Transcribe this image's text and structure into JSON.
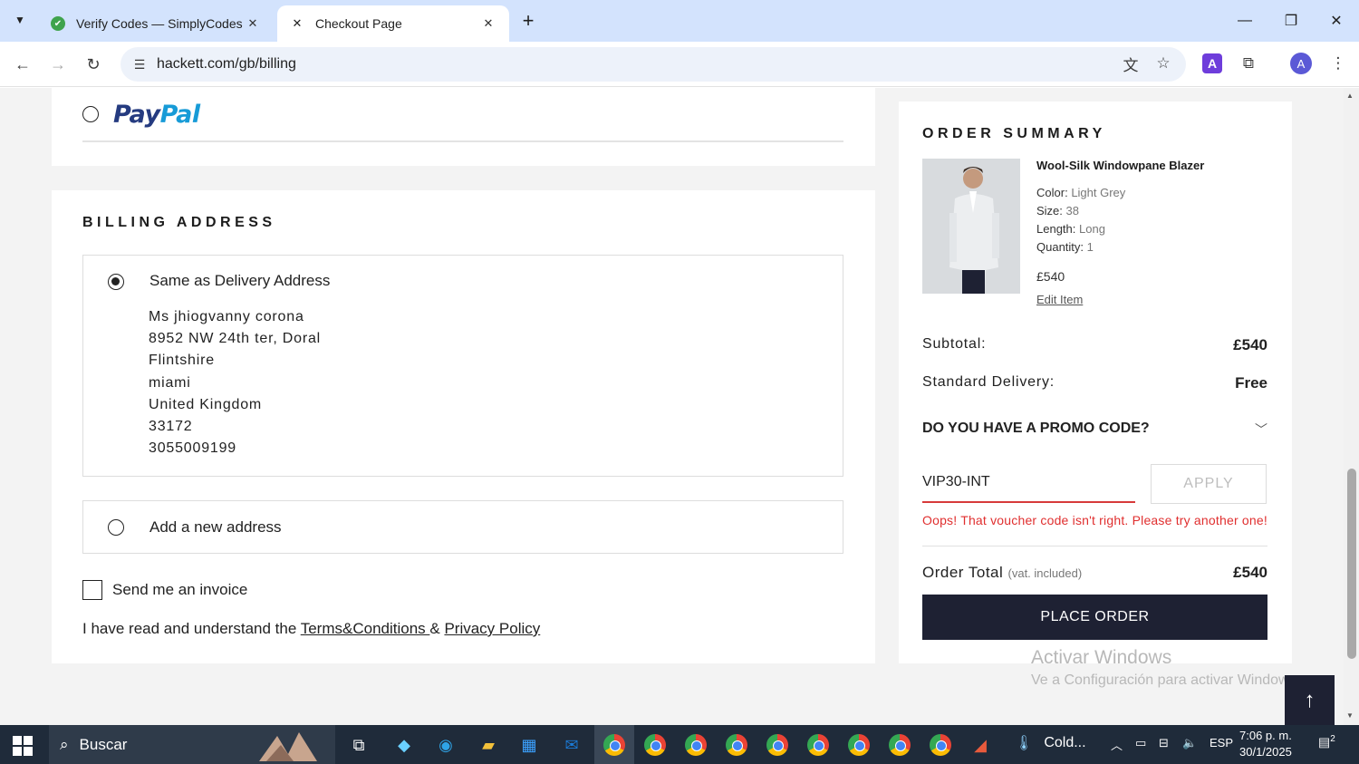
{
  "browser": {
    "tabs": [
      {
        "title": "Verify Codes — SimplyCodes",
        "active": false
      },
      {
        "title": "Checkout Page",
        "active": true
      }
    ],
    "url": "hackett.com/gb/billing"
  },
  "payment": {
    "paypal_logo_part1": "Pay",
    "paypal_logo_part2": "Pal"
  },
  "billing": {
    "title": "BILLING ADDRESS",
    "same_as_delivery_label": "Same as Delivery Address",
    "address_lines": [
      "Ms jhiogvanny corona",
      "8952 NW 24th ter, Doral",
      "Flintshire",
      "miami",
      "United Kingdom",
      "33172",
      "3055009199"
    ],
    "add_new_label": "Add a new address",
    "invoice_label": "Send me an invoice",
    "terms_prefix": "I have read and understand the ",
    "terms_link": "Terms&Conditions ",
    "terms_and": " & ",
    "privacy_link": "Privacy Policy"
  },
  "order_summary": {
    "title": "ORDER SUMMARY",
    "product": {
      "name": "Wool-Silk Windowpane Blazer",
      "color_label": "Color:",
      "color_value": "Light Grey",
      "size_label": "Size:",
      "size_value": "38",
      "length_label": "Length:",
      "length_value": "Long",
      "quantity_label": "Quantity:",
      "quantity_value": "1",
      "price": "£540",
      "edit_label": "Edit Item"
    },
    "subtotal_label": "Subtotal:",
    "subtotal_value": "£540",
    "delivery_label": "Standard Delivery:",
    "delivery_value": "Free",
    "promo_question": "DO YOU HAVE A PROMO CODE?",
    "promo_value": "VIP30-INT",
    "apply_label": "APPLY",
    "promo_error": "Oops! That voucher code isn't right. Please try another one!",
    "total_label": "Order Total",
    "total_note": "(vat. included)",
    "total_value": "£540",
    "place_order_label": "PLACE ORDER"
  },
  "watermark": {
    "line1": "Activar Windows",
    "line2": "Ve a Configuración para activar Windows."
  },
  "taskbar": {
    "search_label": "Buscar",
    "weather": "Cold...",
    "lang": "ESP",
    "time": "7:06 p. m.",
    "date": "30/1/2025",
    "notif_count": "2"
  },
  "colors": {
    "accent_dark": "#1e2133",
    "error": "#e02f2f",
    "tabbar": "#d3e3fd"
  }
}
